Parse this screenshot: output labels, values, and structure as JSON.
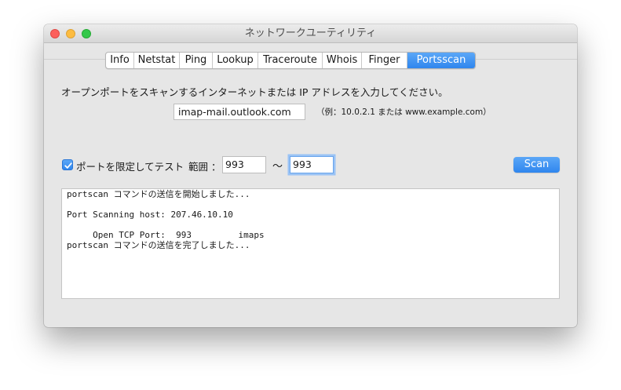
{
  "window": {
    "title": "ネットワークユーティリティ"
  },
  "tabs": [
    {
      "label": "Info",
      "width": 36
    },
    {
      "label": "Netstat",
      "width": 58
    },
    {
      "label": "Ping",
      "width": 42
    },
    {
      "label": "Lookup",
      "width": 58
    },
    {
      "label": "Traceroute",
      "width": 82
    },
    {
      "label": "Whois",
      "width": 50
    },
    {
      "label": "Finger",
      "width": 58
    },
    {
      "label": "Portsscan",
      "width": 86
    }
  ],
  "active_tab": "Portsscan",
  "instruction": "オープンポートをスキャンするインターネットまたは IP アドレスを入力してください。",
  "host_input": {
    "value": "imap-mail.outlook.com"
  },
  "example": "（例：10.0.2.1 または www.example.com）",
  "port_limit": {
    "checked": true,
    "label": "ポートを限定してテスト",
    "range_label": "範囲 ：",
    "from": "993",
    "separator": "〜",
    "to": "993"
  },
  "scan_button": "Scan",
  "output_lines": [
    "portscan コマンドの送信を開始しました...",
    "",
    "Port Scanning host: 207.46.10.10",
    "",
    "     Open TCP Port:  993         imaps",
    "portscan コマンドの送信を完了しました..."
  ],
  "colors": {
    "accent": "#2f86ee",
    "window_bg": "#e6e6e6"
  }
}
